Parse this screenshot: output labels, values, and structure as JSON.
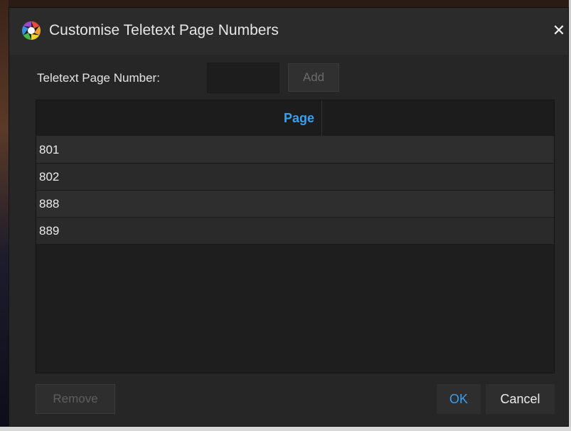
{
  "dialog": {
    "title": "Customise Teletext Page Numbers",
    "close_glyph": "✕",
    "app_icon": "aperture-icon"
  },
  "form": {
    "label": "Teletext Page Number:",
    "input_value": "",
    "add_label": "Add"
  },
  "table": {
    "columns": [
      "Page"
    ],
    "rows": [
      "801",
      "802",
      "888",
      "889"
    ]
  },
  "buttons": {
    "remove_label": "Remove",
    "ok_label": "OK",
    "cancel_label": "Cancel"
  },
  "colors": {
    "accent": "#3aa0f0",
    "dialog_bg": "#262626",
    "disabled_text": "#6a6a6a"
  }
}
